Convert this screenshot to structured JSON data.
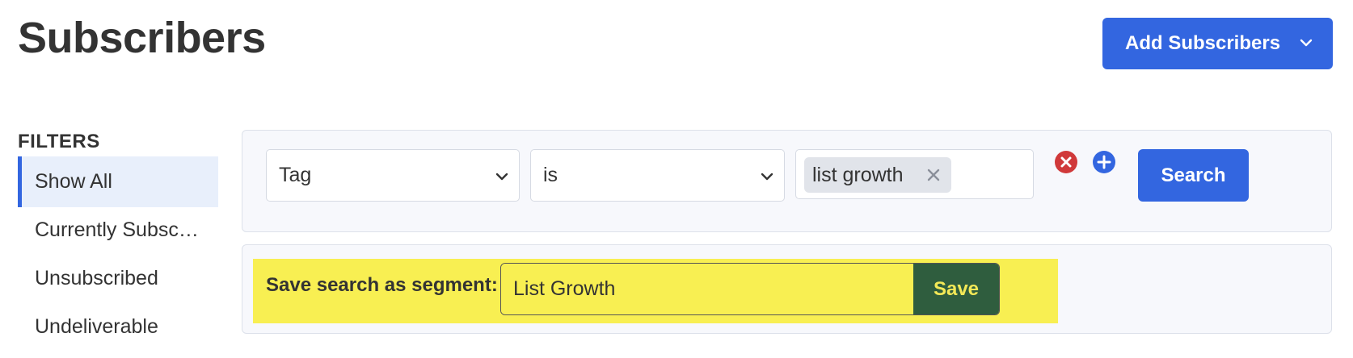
{
  "header": {
    "title": "Subscribers",
    "add_button_label": "Add Subscribers",
    "add_button_icon": "chevron-down-icon"
  },
  "sidebar": {
    "heading": "FILTERS",
    "items": [
      {
        "label": "Show All",
        "active": true
      },
      {
        "label": "Currently Subscribed",
        "active": false
      },
      {
        "label": "Unsubscribed",
        "active": false
      },
      {
        "label": "Undeliverable",
        "active": false
      }
    ]
  },
  "filter_row": {
    "field_select": {
      "value": "Tag"
    },
    "operator_select": {
      "value": "is"
    },
    "tag_input": {
      "tags": [
        "list growth"
      ],
      "remove_icon": "close-icon"
    },
    "remove_filter_icon": "remove-circle-icon",
    "add_filter_icon": "add-circle-icon",
    "search_button_label": "Search"
  },
  "segment": {
    "label": "Save search as segment:",
    "input_value": "List Growth",
    "save_button_label": "Save"
  },
  "colors": {
    "accent": "#3366e0",
    "highlight": "#f8ef52",
    "save_button_bg": "#2f5d3e",
    "remove_icon": "#d0393a"
  }
}
